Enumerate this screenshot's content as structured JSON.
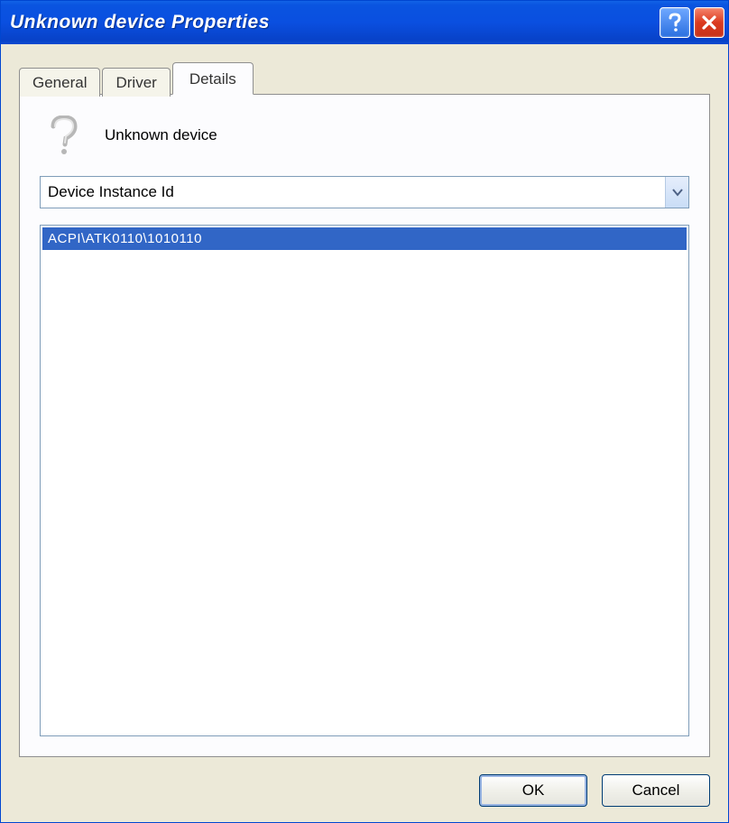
{
  "window": {
    "title": "Unknown device Properties"
  },
  "tabs": {
    "general": "General",
    "driver": "Driver",
    "details": "Details"
  },
  "details": {
    "device_name": "Unknown device",
    "dropdown_selected": "Device Instance Id",
    "list_items": [
      "ACPI\\ATK0110\\1010110"
    ]
  },
  "buttons": {
    "ok": "OK",
    "cancel": "Cancel"
  }
}
